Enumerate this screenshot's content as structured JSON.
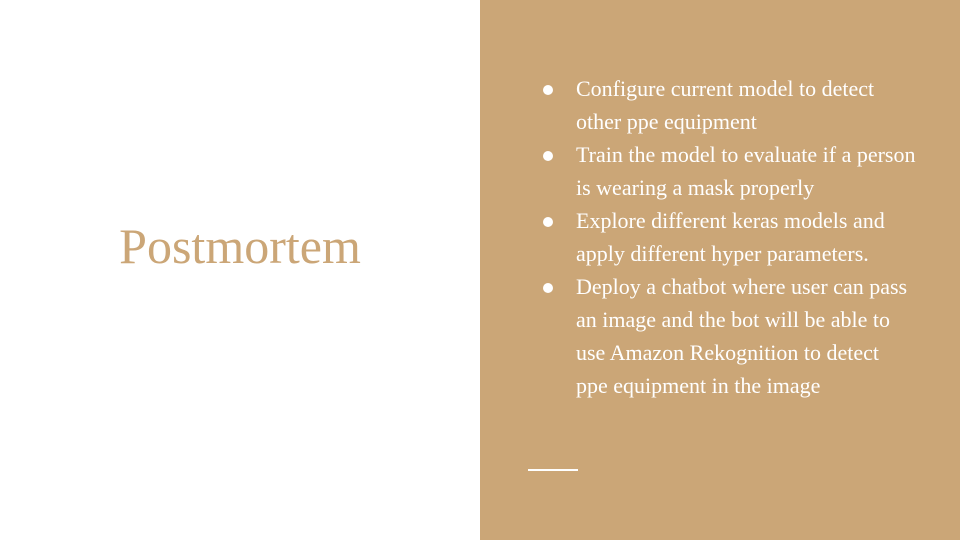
{
  "slide": {
    "title": "Postmortem",
    "bullets": [
      "Configure current model to detect other ppe equipment",
      "Train the model to evaluate if a person is wearing a mask properly",
      "Explore different keras models and apply different hyper parameters.",
      "Deploy a chatbot where user can pass an image and the bot will be able to use Amazon Rekognition to detect ppe equipment in the image"
    ]
  },
  "colors": {
    "accent": "#cba677",
    "text_on_accent": "#ffffff",
    "background": "#ffffff"
  }
}
